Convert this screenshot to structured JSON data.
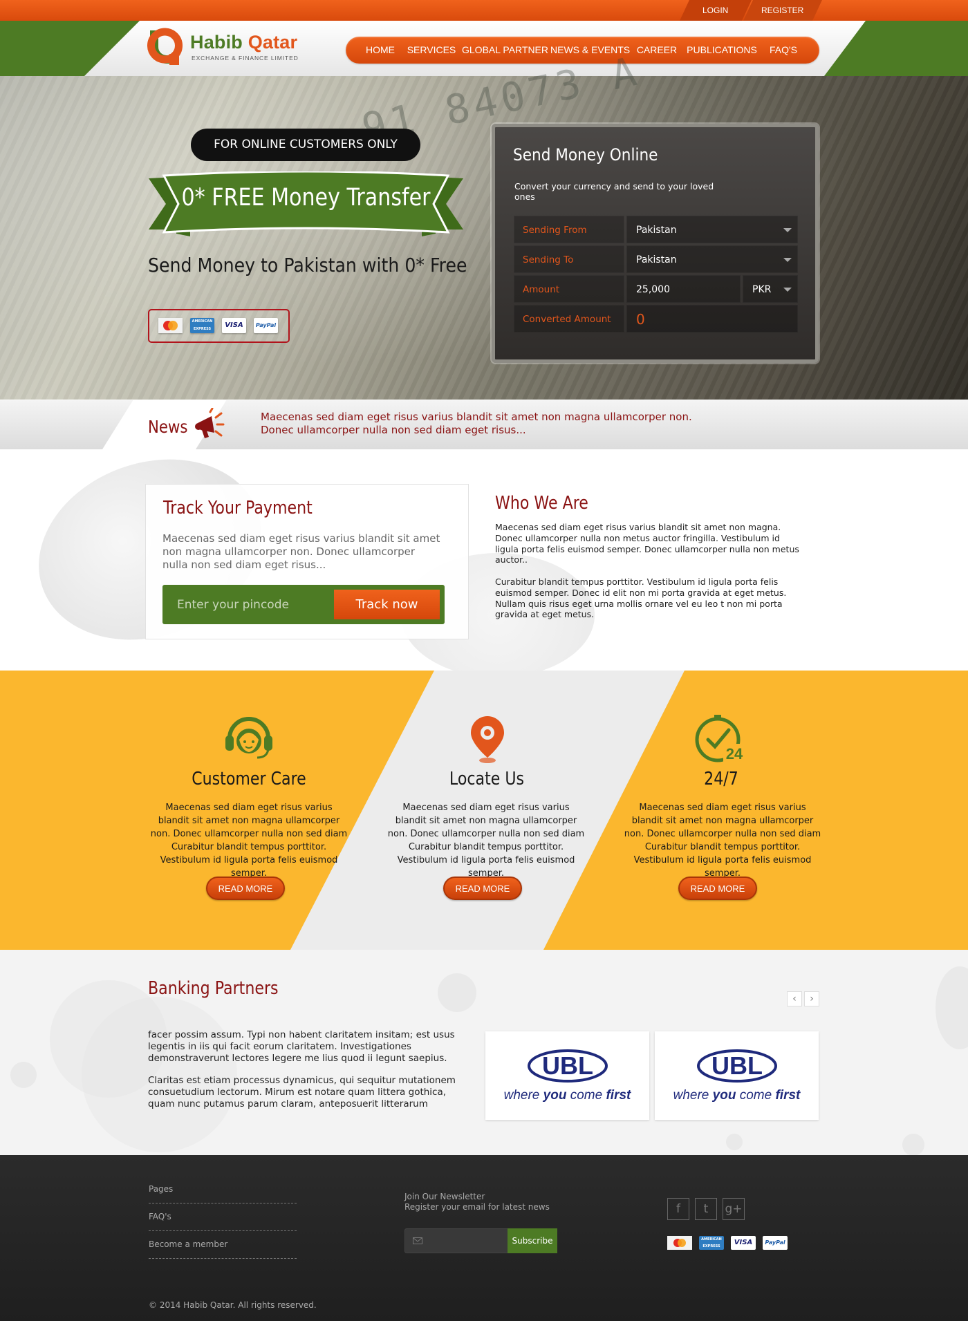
{
  "topbar": {
    "login": "LOGIN",
    "register": "REGISTER"
  },
  "logo": {
    "name_part1": "Habib ",
    "name_part2": "Qatar",
    "subtitle": "EXCHANGE & FINANCE LIMITED"
  },
  "nav": [
    "HOME",
    "SERVICES",
    "GLOBAL PARTNER",
    "NEWS & EVENTS",
    "CAREER",
    "PUBLICATIONS",
    "FAQ'S"
  ],
  "hero": {
    "pill": "FOR ONLINE CUSTOMERS ONLY",
    "ribbon": "0* FREE Money Transfer",
    "tagline": "Send Money to Pakistan with 0* Free",
    "digits": "91 84073 A",
    "cards": [
      "MasterCard",
      "AMERICAN EXPRESS",
      "VISA",
      "PayPal"
    ]
  },
  "send_money": {
    "title": "Send Money Online",
    "subtitle": "Convert your currency and send to your loved ones",
    "sending_from_label": "Sending From",
    "sending_from_value": "Pakistan",
    "sending_to_label": "Sending To",
    "sending_to_value": "Pakistan",
    "amount_label": "Amount",
    "amount_value": "25,000",
    "currency": "PKR",
    "converted_label": "Converted Amount",
    "converted_value": "0"
  },
  "news": {
    "title": "News",
    "line1": "Maecenas sed diam eget risus varius blandit sit amet non magna ullamcorper non.",
    "line2": "Donec ullamcorper nulla non sed diam eget risus..."
  },
  "track": {
    "title": "Track Your Payment",
    "text": "Maecenas sed diam eget risus varius blandit sit amet non magna ullamcorper non. Donec ullamcorper nulla non sed diam eget risus...",
    "placeholder": "Enter your pincode",
    "button": "Track now"
  },
  "who": {
    "title": "Who We Are",
    "p1": "Maecenas sed diam eget risus varius blandit sit amet non magna. Donec ullamcorper nulla non metus auctor fringilla. Vestibulum id ligula porta felis euismod semper. Donec ullamcorper nulla non metus auctor..",
    "p2": "Curabitur blandit tempus porttitor. Vestibulum id ligula porta felis euismod semper. Donec id elit non mi porta gravida at eget metus. Nullam quis risus eget urna mollis ornare vel eu leo t non mi porta gravida at eget metus."
  },
  "features": [
    {
      "title": "Customer Care",
      "icon": "headset-icon",
      "text": "Maecenas sed diam eget risus varius blandit sit amet non magna ullamcorper non. Donec ullamcorper nulla non sed diam Curabitur blandit tempus porttitor. Vestibulum id ligula porta felis euismod semper.",
      "button": "READ MORE"
    },
    {
      "title": "Locate Us",
      "icon": "location-pin-icon",
      "text": "Maecenas sed diam eget risus varius blandit sit amet non magna ullamcorper non. Donec ullamcorper nulla non sed diam Curabitur blandit tempus porttitor. Vestibulum id ligula porta felis euismod semper.",
      "button": "READ MORE"
    },
    {
      "title": "24/7",
      "icon": "clock-24-icon",
      "icon_text": "24",
      "text": "Maecenas sed diam eget risus varius blandit sit amet non magna ullamcorper non. Donec ullamcorper nulla non sed diam Curabitur blandit tempus porttitor. Vestibulum id ligula porta felis euismod semper.",
      "button": "READ MORE"
    }
  ],
  "partners": {
    "title": "Banking Partners",
    "p1": "facer possim assum. Typi non habent claritatem insitam; est usus legentis in iis qui facit eorum claritatem. Investigationes demonstraverunt lectores legere me lius quod ii legunt saepius.",
    "p2": "Claritas est etiam processus dynamicus, qui sequitur mutationem consuetudium lectorum. Mirum est notare quam littera gothica, quam nunc putamus parum claram, anteposuerit litterarum",
    "prev": "‹",
    "next": "›",
    "logos": [
      {
        "name": "UBL",
        "slogan_1": "where ",
        "slogan_you": "you",
        "slogan_2": " come ",
        "slogan_first": "first"
      },
      {
        "name": "UBL",
        "slogan_1": "where ",
        "slogan_you": "you",
        "slogan_2": " come ",
        "slogan_first": "first"
      }
    ]
  },
  "footer": {
    "links": [
      "Pages",
      "FAQ's",
      "Become a member"
    ],
    "newsletter_title": "Join Our Newsletter",
    "newsletter_sub": "Register your email for latest news",
    "subscribe": "Subscribe",
    "social": {
      "facebook": "f",
      "twitter": "t",
      "google": "g+"
    },
    "cards": [
      "MasterCard",
      "AMERICAN EXPRESS",
      "VISA",
      "PayPal"
    ],
    "copyright": "© 2014 Habib Qatar. All rights reserved."
  },
  "colors": {
    "orange": "#e2561c",
    "green": "#4d7b24",
    "maroon": "#8a1313",
    "yellow": "#fbb72e",
    "dark": "#242424"
  }
}
